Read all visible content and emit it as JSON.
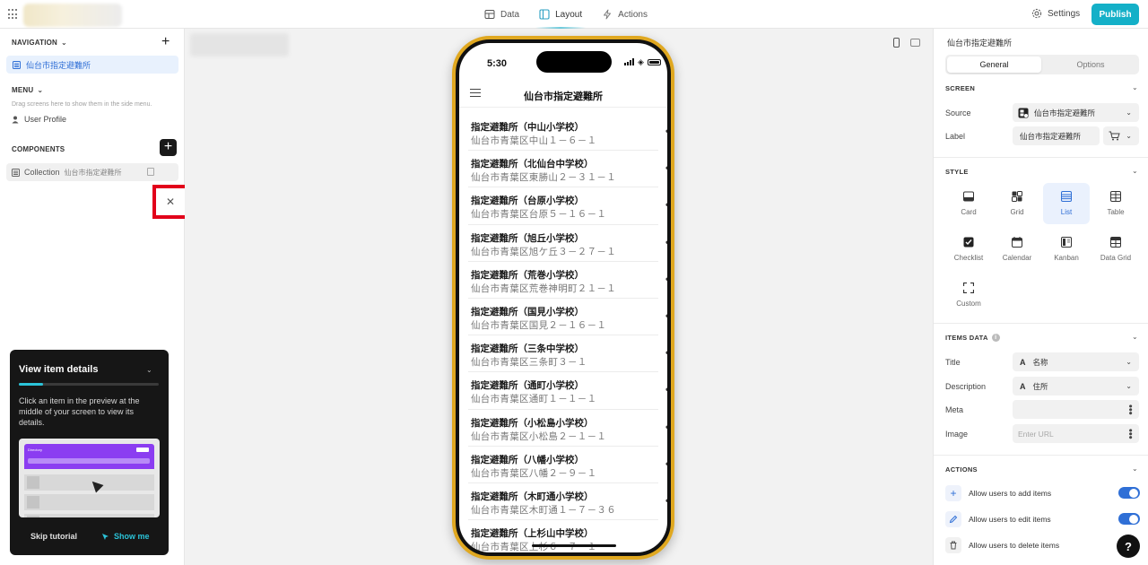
{
  "topbar": {
    "tabs": [
      {
        "label": "Data",
        "icon": "database-icon"
      },
      {
        "label": "Layout",
        "icon": "layout-icon"
      },
      {
        "label": "Actions",
        "icon": "bolt-icon"
      }
    ],
    "settings_label": "Settings",
    "publish_label": "Publish",
    "accent": "#14b0c8"
  },
  "left": {
    "navigation_title": "NAVIGATION",
    "nav_item": "仙台市指定避難所",
    "menu_title": "MENU",
    "menu_hint": "Drag screens here to show them in the side menu.",
    "user_profile": "User Profile",
    "components_title": "COMPONENTS",
    "collection_label": "Collection",
    "collection_source": "仙台市指定避難所",
    "delete_symbol": "✕"
  },
  "tutorial": {
    "title": "View item details",
    "text": "Click an item in the preview at the middle of your screen to view its details.",
    "preview_title": "Directory",
    "skip_label": "Skip tutorial",
    "show_label": "Show me",
    "progress": 0.17
  },
  "phone": {
    "time": "5:30",
    "title": "仙台市指定避難所",
    "items": [
      {
        "title": "指定避難所（中山小学校）",
        "desc": "仙台市青葉区中山１－６－１"
      },
      {
        "title": "指定避難所（北仙台中学校）",
        "desc": "仙台市青葉区東勝山２－３１－１"
      },
      {
        "title": "指定避難所（台原小学校）",
        "desc": "仙台市青葉区台原５－１６－１"
      },
      {
        "title": "指定避難所（旭丘小学校）",
        "desc": "仙台市青葉区旭ケ丘３－２７－１"
      },
      {
        "title": "指定避難所（荒巻小学校）",
        "desc": "仙台市青葉区荒巻神明町２１－１"
      },
      {
        "title": "指定避難所（国見小学校）",
        "desc": "仙台市青葉区国見２－１６－１"
      },
      {
        "title": "指定避難所（三条中学校）",
        "desc": "仙台市青葉区三条町３－１"
      },
      {
        "title": "指定避難所（通町小学校）",
        "desc": "仙台市青葉区通町１－１－１"
      },
      {
        "title": "指定避難所（小松島小学校）",
        "desc": "仙台市青葉区小松島２－１－１"
      },
      {
        "title": "指定避難所（八幡小学校）",
        "desc": "仙台市青葉区八幡２－９－１"
      },
      {
        "title": "指定避難所（木町通小学校）",
        "desc": "仙台市青葉区木町通１－７－３６"
      },
      {
        "title": "指定避難所（上杉山中学校）",
        "desc": "仙台市青葉区上杉６－７－１"
      }
    ],
    "more": "•••",
    "frame_color": "#e0a820"
  },
  "right": {
    "title": "仙台市指定避難所",
    "tab_general": "General",
    "tab_options": "Options",
    "screen_title": "SCREEN",
    "source_label": "Source",
    "source_value": "仙台市指定避難所",
    "label_label": "Label",
    "label_value": "仙台市指定避難所",
    "style_title": "STYLE",
    "styles": [
      "Card",
      "Grid",
      "List",
      "Table",
      "Checklist",
      "Calendar",
      "Kanban",
      "Data Grid",
      "Custom"
    ],
    "selected_style": "List",
    "items_data_title": "ITEMS DATA",
    "title_label": "Title",
    "title_value": "名称",
    "description_label": "Description",
    "description_value": "住所",
    "meta_label": "Meta",
    "image_label": "Image",
    "image_placeholder": "Enter URL",
    "actions_title": "ACTIONS",
    "action_add": "Allow users to add items",
    "action_edit": "Allow users to edit items",
    "action_delete": "Allow users to delete items",
    "toggle_add": true,
    "toggle_edit": true
  },
  "help_label": "?"
}
